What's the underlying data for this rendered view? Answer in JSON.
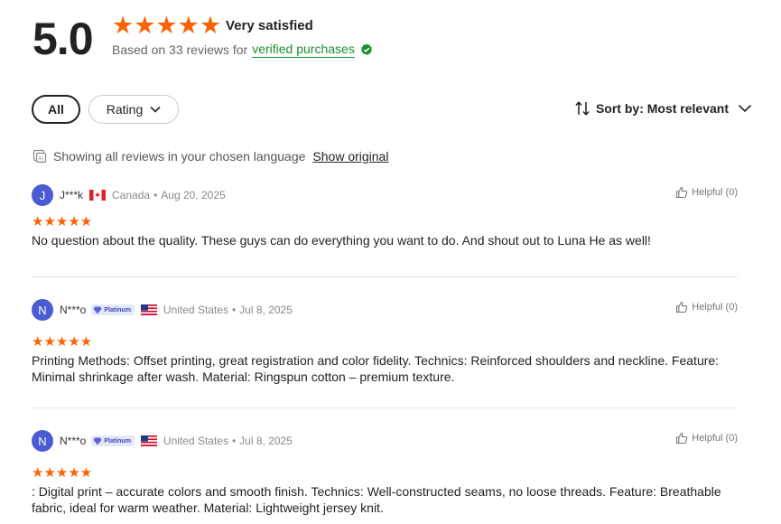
{
  "summary": {
    "score": "5.0",
    "stars": "★★★★★",
    "satisfaction": "Very satisfied",
    "based_on": "Based on 33 reviews for",
    "verified_link": "verified purchases"
  },
  "filters": {
    "all_label": "All",
    "rating_label": "Rating"
  },
  "sort": {
    "label": "Sort by: Most relevant"
  },
  "language": {
    "note": "Showing all reviews in your chosen language",
    "show_original": "Show original"
  },
  "reviews": [
    {
      "initial": "J",
      "name": "J***k",
      "flag": "canada-flag",
      "country": "Canada",
      "dot": "•",
      "date": "Aug 20, 2025",
      "helpful": "Helpful (0)",
      "stars": "★★★★★",
      "text": "No question about the quality.  These guys can do everything you want to do. And shout out to Luna He as well!"
    },
    {
      "initial": "N",
      "name": "N***o",
      "badge": "Platinum",
      "flag": "us-flag",
      "country": "United States",
      "dot": "•",
      "date": "Jul 8, 2025",
      "helpful": "Helpful (0)",
      "stars": "★★★★★",
      "text": "Printing Methods: Offset printing, great registration and color fidelity. Technics: Reinforced shoulders and neckline. Feature: Minimal shrinkage after wash. Material: Ringspun cotton – premium texture."
    },
    {
      "initial": "N",
      "name": "N***o",
      "badge": "Platinum",
      "flag": "us-flag",
      "country": "United States",
      "dot": "•",
      "date": "Jul 8, 2025",
      "helpful": "Helpful (0)",
      "stars": "★★★★★",
      "text": ": Digital print – accurate colors and smooth finish. Technics: Well-constructed seams, no loose threads. Feature: Breathable fabric, ideal for warm weather. Material: Lightweight jersey knit."
    }
  ],
  "colors": {
    "star": "#fb6203",
    "verified": "#1a8f2d",
    "avatar": "#4a5bd4"
  }
}
